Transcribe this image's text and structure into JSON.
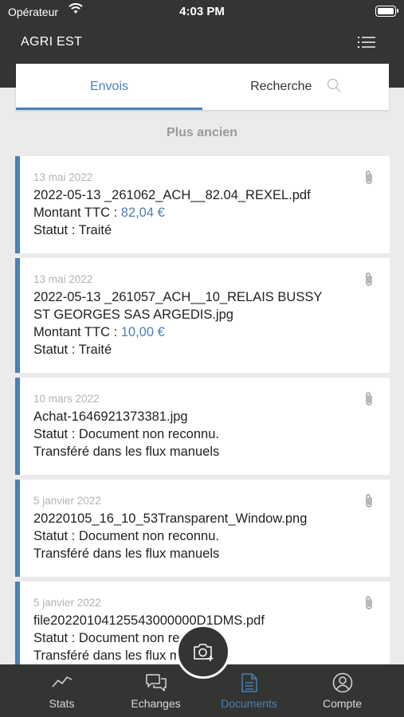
{
  "status_bar": {
    "carrier": "Opérateur",
    "time": "4:03 PM"
  },
  "header": {
    "title": "AGRI EST",
    "menu_icon": "list-menu-icon"
  },
  "tabs": [
    {
      "label": "Envois",
      "active": true
    },
    {
      "label": "Recherche",
      "active": false,
      "icon": "search-icon"
    }
  ],
  "section_label": "Plus ancien",
  "documents": [
    {
      "date": "13 mai 2022",
      "name": "2022-05-13 _261062_ACH__82.04_REXEL.pdf",
      "amount_label": "Montant TTC : ",
      "amount": "82,04 €",
      "status": "Statut : Traité"
    },
    {
      "date": "13 mai 2022",
      "name_line1": "2022-05-13 _261057_ACH__10_RELAIS BUSSY",
      "name_line2": "ST GEORGES SAS ARGEDIS.jpg",
      "amount_label": "Montant TTC : ",
      "amount": "10,00 €",
      "status": "Statut : Traité"
    },
    {
      "date": "10 mars 2022",
      "name": "Achat-1646921373381.jpg",
      "status": "Statut : Document non reconnu.",
      "note": "Transféré dans les flux manuels"
    },
    {
      "date": "5 janvier 2022",
      "name": "20220105_16_10_53Transparent_Window.png",
      "status": "Statut : Document non reconnu.",
      "note": "Transféré dans les flux manuels"
    },
    {
      "date": "5 janvier 2022",
      "name": "file20220104125543000000D1DMS.pdf",
      "status": "Statut : Document non reconnu.",
      "note": "Transféré dans les flux manuels"
    }
  ],
  "tabbar": [
    {
      "label": "Stats",
      "icon": "stats-icon"
    },
    {
      "label": "Echanges",
      "icon": "chat-icon"
    },
    {
      "label": "Documents",
      "icon": "document-icon",
      "active": true
    },
    {
      "label": "Compte",
      "icon": "account-icon"
    }
  ],
  "colors": {
    "accent": "#4a7fb8",
    "dark": "#333533",
    "background": "#ebebeb"
  }
}
